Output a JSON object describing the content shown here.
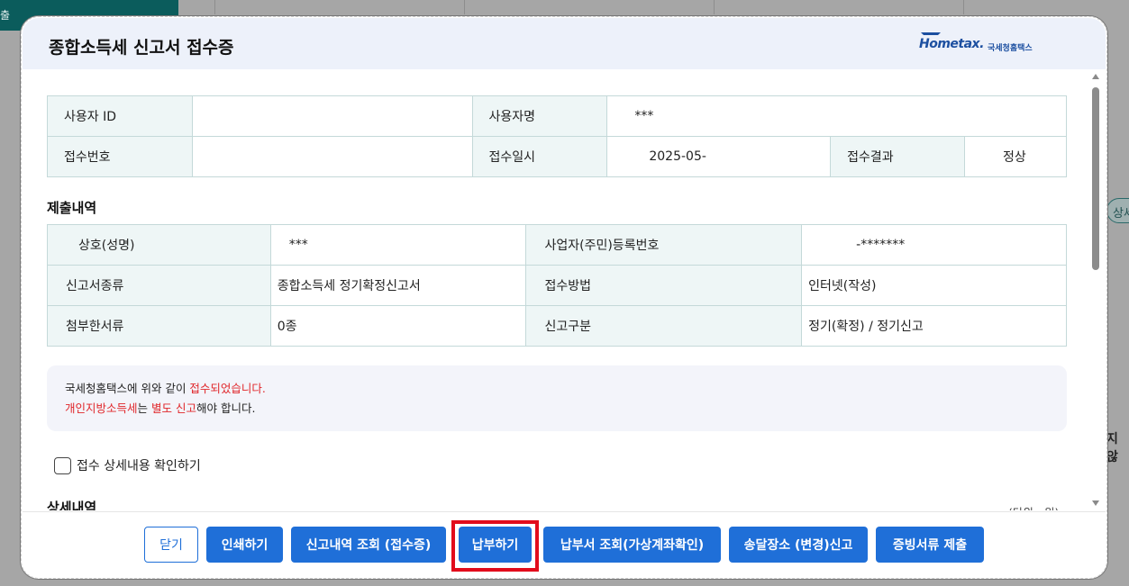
{
  "background": {
    "sidebar_tab": "출",
    "pill_text": "상세",
    "side_text": "지 않"
  },
  "modal": {
    "title": "종합소득세 신고서 접수증",
    "logo": {
      "en_text": "Hometax.",
      "ko_text": "국세청홈택스"
    }
  },
  "receipt": {
    "user_id_label": "사용자 ID",
    "user_id_value": "",
    "user_name_label": "사용자명",
    "user_name_value": "***",
    "receipt_no_label": "접수번호",
    "receipt_no_value": "",
    "receipt_date_label": "접수일시",
    "receipt_date_value": "2025-05-",
    "result_label": "접수결과",
    "result_value": "정상"
  },
  "submission": {
    "title": "제출내역",
    "rows": [
      {
        "label1": "상호(성명)",
        "value1": "***",
        "label2": "사업자(주민)등록번호",
        "value2": "-*******"
      },
      {
        "label1": "신고서종류",
        "value1": "종합소득세 정기확정신고서",
        "label2": "접수방법",
        "value2": "인터넷(작성)"
      },
      {
        "label1": "첨부한서류",
        "value1": "0종",
        "label2": "신고구분",
        "value2": "정기(확정) / 정기신고"
      }
    ]
  },
  "notice": {
    "line1_prefix": "국세청홈택스에 위와 같이 ",
    "line1_red": "접수되었습니다.",
    "line2_red1": "개인지방소득세",
    "line2_mid": "는 ",
    "line2_red2": "별도 신고",
    "line2_suffix": "해야 합니다."
  },
  "checkbox": {
    "label": "접수 상세내용 확인하기"
  },
  "detail": {
    "title": "상세내역",
    "unit": "(단위 : 원)"
  },
  "buttons": {
    "close": "닫기",
    "print": "인쇄하기",
    "history": "신고내역 조회 (접수증)",
    "pay": "납부하기",
    "pay_slip": "납부서 조회(가상계좌확인)",
    "address": "송달장소 (변경)신고",
    "evidence": "증빙서류 제출"
  },
  "colors": {
    "primary": "#1f6fd8",
    "highlight": "#e20c1c",
    "notice_red": "#e0262a"
  }
}
